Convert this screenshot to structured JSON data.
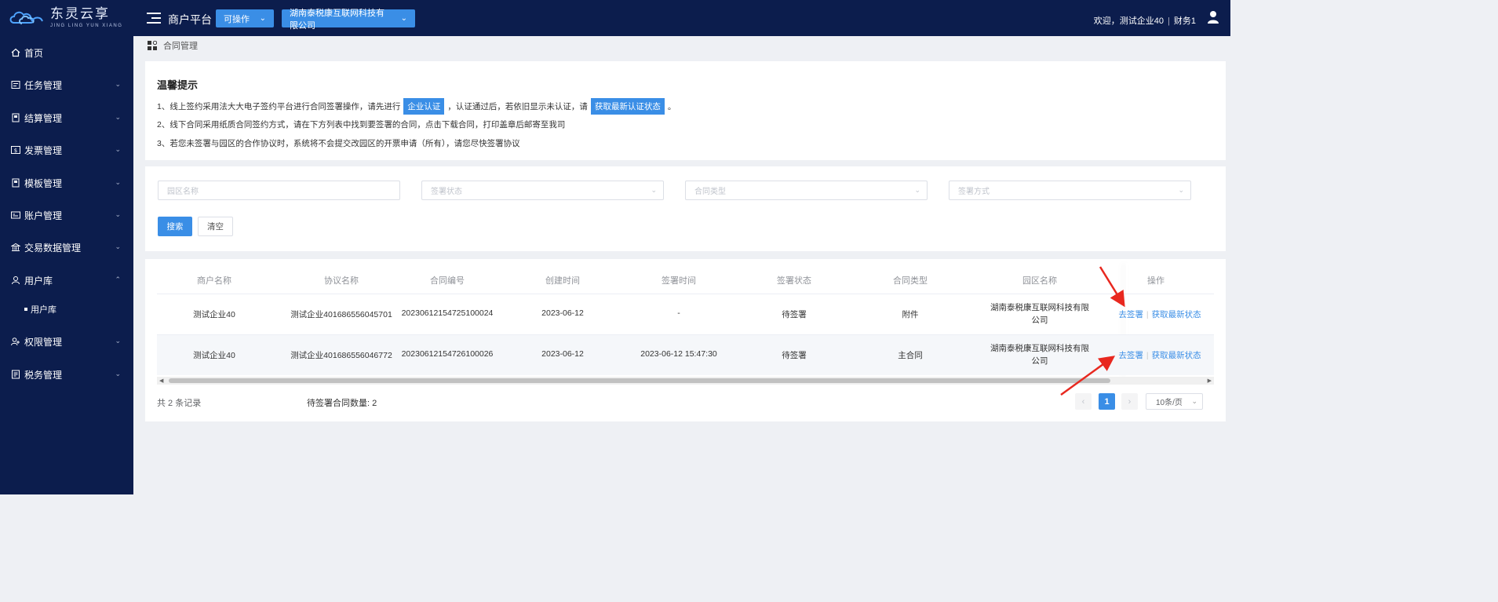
{
  "brand": {
    "name_cn": "东灵云享",
    "name_en": "JING LING YUN XIANG"
  },
  "header": {
    "platform_title": "商户平台",
    "status_dropdown": "可操作",
    "company_dropdown": "湖南泰税康互联网科技有限公司",
    "welcome": "欢迎，测试企业40",
    "role": "财务1"
  },
  "sidebar": {
    "items": [
      {
        "label": "首页",
        "icon": "home-icon"
      },
      {
        "label": "任务管理",
        "icon": "task-icon"
      },
      {
        "label": "结算管理",
        "icon": "settlement-icon"
      },
      {
        "label": "发票管理",
        "icon": "invoice-icon"
      },
      {
        "label": "模板管理",
        "icon": "template-icon"
      },
      {
        "label": "账户管理",
        "icon": "account-icon"
      },
      {
        "label": "交易数据管理",
        "icon": "bank-icon"
      },
      {
        "label": "用户库",
        "icon": "user-icon"
      },
      {
        "label": "权限管理",
        "icon": "permission-icon"
      },
      {
        "label": "税务管理",
        "icon": "tax-icon"
      }
    ],
    "sub_item": "用户库"
  },
  "breadcrumb": "合同管理",
  "tips": {
    "title": "温馨提示",
    "line1_a": "1、线上签约采用法大大电子签约平台进行合同签署操作，请先进行",
    "line1_tag1": "企业认证",
    "line1_b": "，认证通过后，若依旧显示未认证，请",
    "line1_tag2": "获取最新认证状态",
    "line1_c": "。",
    "line2": "2、线下合同采用纸质合同签约方式，请在下方列表中找到要签署的合同，点击下载合同，打印盖章后邮寄至我司",
    "line3": "3、若您未签署与园区的合作协议时，系统将不会提交改园区的开票申请（所有），请您尽快签署协议"
  },
  "filters": {
    "park_placeholder": "园区名称",
    "sign_status_placeholder": "签署状态",
    "contract_type_placeholder": "合同类型",
    "sign_method_placeholder": "签署方式",
    "search_label": "搜索",
    "clear_label": "清空"
  },
  "table": {
    "columns": [
      "商户名称",
      "协议名称",
      "合同编号",
      "创建时间",
      "签署时间",
      "签署状态",
      "合同类型",
      "园区名称",
      "操作"
    ],
    "rows": [
      {
        "merchant": "测试企业40",
        "agreement": "测试企业401686556045701",
        "contract_no": "20230612154725100024",
        "created": "2023-06-12",
        "signed": "-",
        "status": "待签署",
        "type": "附件",
        "park_line1": "湖南泰税康互联网科技有限",
        "park_line2": "公司",
        "action_sign": "去签署",
        "action_refresh": "获取最新状态"
      },
      {
        "merchant": "测试企业40",
        "agreement": "测试企业401686556046772",
        "contract_no": "20230612154726100026",
        "created": "2023-06-12",
        "signed": "2023-06-12 15:47:30",
        "status": "待签署",
        "type": "主合同",
        "park_line1": "湖南泰税康互联网科技有限",
        "park_line2": "公司",
        "action_sign": "去签署",
        "action_refresh": "获取最新状态"
      }
    ]
  },
  "footer": {
    "total": "共 2 条记录",
    "pending": "待签署合同数量: 2",
    "page": "1",
    "page_size": "10条/页"
  },
  "colors": {
    "nav_bg": "#0c1d4d",
    "primary": "#3a8ee6",
    "annotation": "#e8281f"
  }
}
